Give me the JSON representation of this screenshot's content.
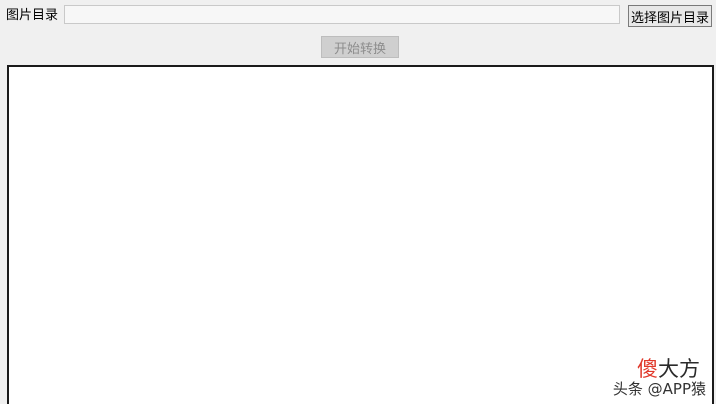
{
  "toolbar": {
    "dir_label": "图片目录",
    "dir_value": "",
    "choose_button": "选择图片目录",
    "start_button": "开始转换"
  },
  "log": {
    "content": ""
  },
  "watermark": {
    "brand_red": "傻",
    "brand_rest": "大方",
    "caption": "头条 @APP猿"
  }
}
